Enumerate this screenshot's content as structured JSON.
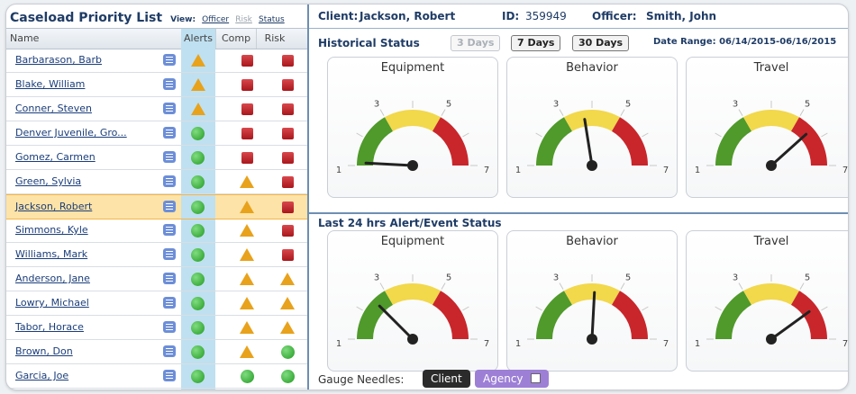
{
  "caseload": {
    "title": "Caseload Priority List",
    "view_label": "View:",
    "view_options": [
      "Officer",
      "Risk",
      "Status"
    ],
    "columns": {
      "name": "Name",
      "alerts": "Alerts",
      "comp": "Comp",
      "risk": "Risk"
    },
    "rows": [
      {
        "name": "Barbarason, Barb",
        "alert": "triangle",
        "comp": "red",
        "risk": "red",
        "selected": false
      },
      {
        "name": "Blake, William",
        "alert": "triangle",
        "comp": "red",
        "risk": "red",
        "selected": false
      },
      {
        "name": "Conner, Steven",
        "alert": "triangle",
        "comp": "red",
        "risk": "red",
        "selected": false
      },
      {
        "name": "Denver Juvenile, Gro...",
        "alert": "green",
        "comp": "red",
        "risk": "red",
        "selected": false
      },
      {
        "name": "Gomez, Carmen",
        "alert": "green",
        "comp": "red",
        "risk": "red",
        "selected": false
      },
      {
        "name": "Green, Sylvia",
        "alert": "green",
        "comp": "triangle",
        "risk": "red",
        "selected": false
      },
      {
        "name": "Jackson, Robert",
        "alert": "green",
        "comp": "triangle",
        "risk": "red",
        "selected": true
      },
      {
        "name": "Simmons, Kyle",
        "alert": "green",
        "comp": "triangle",
        "risk": "red",
        "selected": false
      },
      {
        "name": "Williams, Mark",
        "alert": "green",
        "comp": "triangle",
        "risk": "red",
        "selected": false
      },
      {
        "name": "Anderson, Jane",
        "alert": "green",
        "comp": "triangle",
        "risk": "triangle",
        "selected": false
      },
      {
        "name": "Lowry, Michael",
        "alert": "green",
        "comp": "triangle",
        "risk": "triangle",
        "selected": false
      },
      {
        "name": "Tabor, Horace",
        "alert": "green",
        "comp": "triangle",
        "risk": "triangle",
        "selected": false
      },
      {
        "name": "Brown, Don",
        "alert": "green",
        "comp": "triangle",
        "risk": "green",
        "selected": false
      },
      {
        "name": "Garcia, Joe",
        "alert": "green",
        "comp": "green",
        "risk": "green",
        "selected": false
      }
    ]
  },
  "client": {
    "client_label": "Client:",
    "client_name": "Jackson, Robert",
    "id_label": "ID:",
    "id_value": "359949",
    "officer_label": "Officer:",
    "officer_name": "Smith, John"
  },
  "historical": {
    "title": "Historical Status",
    "buttons": [
      "3 Days",
      "7 Days",
      "30 Days"
    ],
    "date_range": "Date Range: 06/14/2015-06/16/2015",
    "gauges": [
      {
        "title": "Equipment",
        "value": 1.1
      },
      {
        "title": "Behavior",
        "value": 3.7
      },
      {
        "title": "Travel",
        "value": 5.6
      }
    ]
  },
  "last24": {
    "title": "Last 24 hrs Alert/Event Status",
    "gauges": [
      {
        "title": "Equipment",
        "value": 2.5
      },
      {
        "title": "Behavior",
        "value": 4.1
      },
      {
        "title": "Travel",
        "value": 5.8
      }
    ]
  },
  "gauge_labels": [
    "1",
    "3",
    "5",
    "7"
  ],
  "legend": {
    "label": "Gauge Needles:",
    "client": "Client",
    "agency": "Agency"
  },
  "colors": {
    "green": "#4f9a2a",
    "yellow": "#f2d84b",
    "red": "#c9262b",
    "needle": "#222222"
  }
}
